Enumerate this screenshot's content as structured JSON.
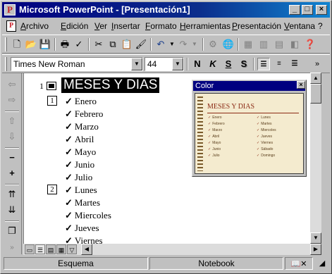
{
  "window": {
    "title": "Microsoft PowerPoint - [Presentación1]",
    "app_icon_letter": "P",
    "controls": {
      "minimize": "_",
      "maximize": "□",
      "close": "×"
    }
  },
  "menubar": {
    "items": [
      {
        "label": "Archivo",
        "underline": "A",
        "rest": "rchivo"
      },
      {
        "label": "Edición",
        "underline": "E",
        "rest": "dición"
      },
      {
        "label": "Ver",
        "underline": "V",
        "rest": "er"
      },
      {
        "label": "Insertar",
        "underline": "I",
        "rest": "nsertar"
      },
      {
        "label": "Formato",
        "underline": "F",
        "rest": "ormato"
      },
      {
        "label": "Herramientas",
        "underline": "H",
        "rest": "erramientas"
      },
      {
        "label": "Presentación",
        "underline": "P",
        "rest": "resentación"
      },
      {
        "label": "Ventana",
        "underline": "V",
        "rest": "entana"
      },
      {
        "label": "?",
        "underline": "",
        "rest": "?"
      }
    ],
    "doc_close": "×"
  },
  "standard_toolbar": {
    "icons": [
      "new-icon",
      "open-icon",
      "save-icon",
      "print-icon",
      "spelling-icon",
      "cut-icon",
      "copy-icon",
      "paste-icon",
      "format-painter-icon",
      "undo-icon",
      "redo-icon",
      "insert-hyperlink-icon",
      "web-toolbar-icon",
      "insert-table-icon",
      "insert-chart-icon",
      "new-slide-icon",
      "help-icon"
    ]
  },
  "formatting_toolbar": {
    "font_name": "Times New Roman",
    "font_size": "44",
    "bold": "N",
    "italic": "K",
    "underline": "S",
    "shadow": "S"
  },
  "outline": {
    "slide_number": "1",
    "title": "MESES Y DIAS",
    "groups": [
      {
        "box": "1",
        "items": [
          "Enero",
          "Febrero",
          "Marzo",
          "Abril",
          "Mayo",
          "Junio",
          "Julio"
        ]
      },
      {
        "box": "2",
        "items": [
          "Lunes",
          "Martes",
          "Miercoles",
          "Jueves",
          "Viernes"
        ]
      }
    ],
    "check": "✓"
  },
  "color_window": {
    "title": "Color",
    "close": "×",
    "preview_title": "MESES Y DIAS",
    "left_col": [
      "Enero",
      "Febrero",
      "Marzo",
      "Abril",
      "Mayo",
      "Junio",
      "Julio"
    ],
    "right_col": [
      "Lunes",
      "Martes",
      "Miercoles",
      "Jueves",
      "Viernes",
      "Sábado",
      "Domingo"
    ],
    "check": "✓"
  },
  "statusbar": {
    "view": "Esquema",
    "design": "Notebook"
  },
  "colors": {
    "titlebar": "#000080",
    "face": "#c0c0c0",
    "preview_bg": "#f4ebcf",
    "preview_accent": "#8b2a14"
  }
}
